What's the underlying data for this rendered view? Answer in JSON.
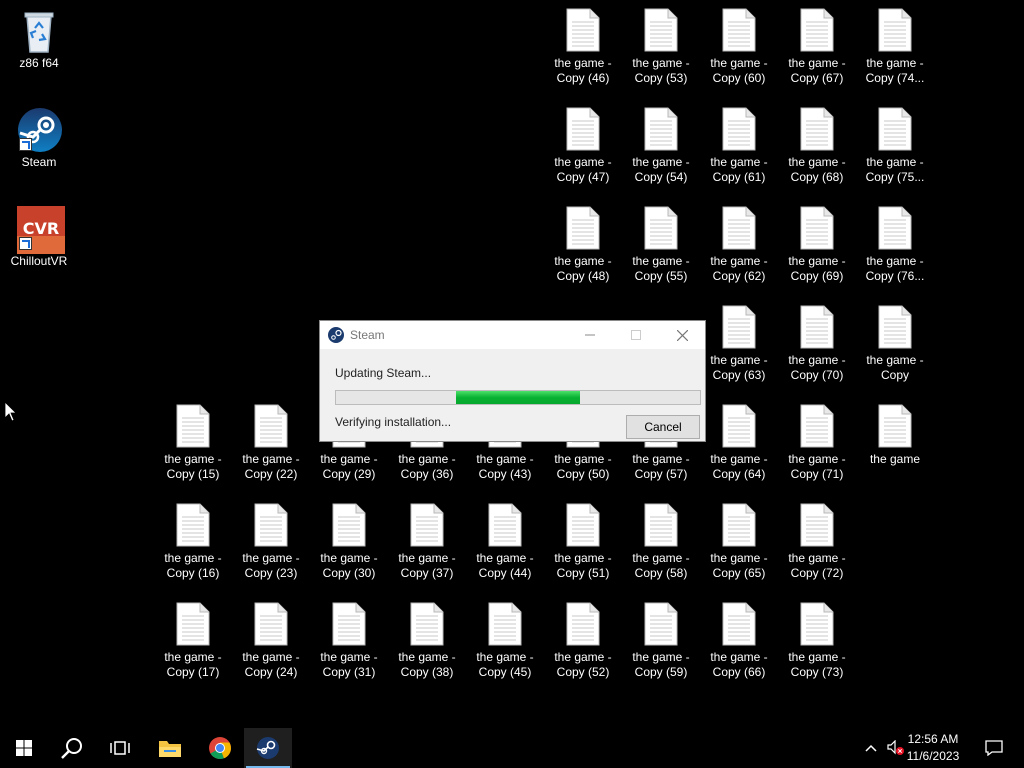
{
  "desktop": {
    "system_icons": [
      {
        "label": "z86 f64",
        "icon": "recycle-bin-icon"
      },
      {
        "label": "Steam",
        "icon": "steam-icon"
      },
      {
        "label": "ChilloutVR",
        "icon": "chilloutvr-icon"
      }
    ],
    "files": [
      {
        "label": "the game -\nCopy (46)"
      },
      {
        "label": "the game -\nCopy (53)"
      },
      {
        "label": "the game -\nCopy (60)"
      },
      {
        "label": "the game -\nCopy (67)"
      },
      {
        "label": "the game -\nCopy (74..."
      },
      {
        "label": "the game -\nCopy (47)"
      },
      {
        "label": "the game -\nCopy (54)"
      },
      {
        "label": "the game -\nCopy (61)"
      },
      {
        "label": "the game -\nCopy (68)"
      },
      {
        "label": "the game -\nCopy (75..."
      },
      {
        "label": "the game -\nCopy (48)"
      },
      {
        "label": "the game -\nCopy (55)"
      },
      {
        "label": "the game -\nCopy (62)"
      },
      {
        "label": "the game -\nCopy (69)"
      },
      {
        "label": "the game -\nCopy (76..."
      },
      {
        "label": "the game -\nCopy (63)"
      },
      {
        "label": "the game -\nCopy (70)"
      },
      {
        "label": "the game -\nCopy"
      },
      {
        "label": "the game -\nCopy (15)"
      },
      {
        "label": "the game -\nCopy (22)"
      },
      {
        "label": "the game -\nCopy (29)"
      },
      {
        "label": "the game -\nCopy (36)"
      },
      {
        "label": "the game -\nCopy (43)"
      },
      {
        "label": "the game -\nCopy (50)"
      },
      {
        "label": "the game -\nCopy (57)"
      },
      {
        "label": "the game -\nCopy (64)"
      },
      {
        "label": "the game -\nCopy (71)"
      },
      {
        "label": "the game"
      },
      {
        "label": "the game -\nCopy (16)"
      },
      {
        "label": "the game -\nCopy (23)"
      },
      {
        "label": "the game -\nCopy (30)"
      },
      {
        "label": "the game -\nCopy (37)"
      },
      {
        "label": "the game -\nCopy (44)"
      },
      {
        "label": "the game -\nCopy (51)"
      },
      {
        "label": "the game -\nCopy (58)"
      },
      {
        "label": "the game -\nCopy (65)"
      },
      {
        "label": "the game -\nCopy (72)"
      },
      {
        "label": "the game -\nCopy (17)"
      },
      {
        "label": "the game -\nCopy (24)"
      },
      {
        "label": "the game -\nCopy (31)"
      },
      {
        "label": "the game -\nCopy (38)"
      },
      {
        "label": "the game -\nCopy (45)"
      },
      {
        "label": "the game -\nCopy (52)"
      },
      {
        "label": "the game -\nCopy (59)"
      },
      {
        "label": "the game -\nCopy (66)"
      },
      {
        "label": "the game -\nCopy (73)"
      }
    ]
  },
  "dialog": {
    "title": "Steam",
    "status": "Updating Steam...",
    "substatus": "Verifying installation...",
    "cancel_label": "Cancel",
    "progress_start": 0.33,
    "progress_end": 0.67,
    "progress_color": "#09b233"
  },
  "taskbar": {
    "items": [
      "windows-start-icon",
      "search-icon",
      "task-view-icon",
      "file-explorer-icon",
      "chrome-icon",
      "steam-icon"
    ],
    "active": "steam-icon",
    "clock_time": "12:56 AM",
    "clock_date": "11/6/2023"
  }
}
